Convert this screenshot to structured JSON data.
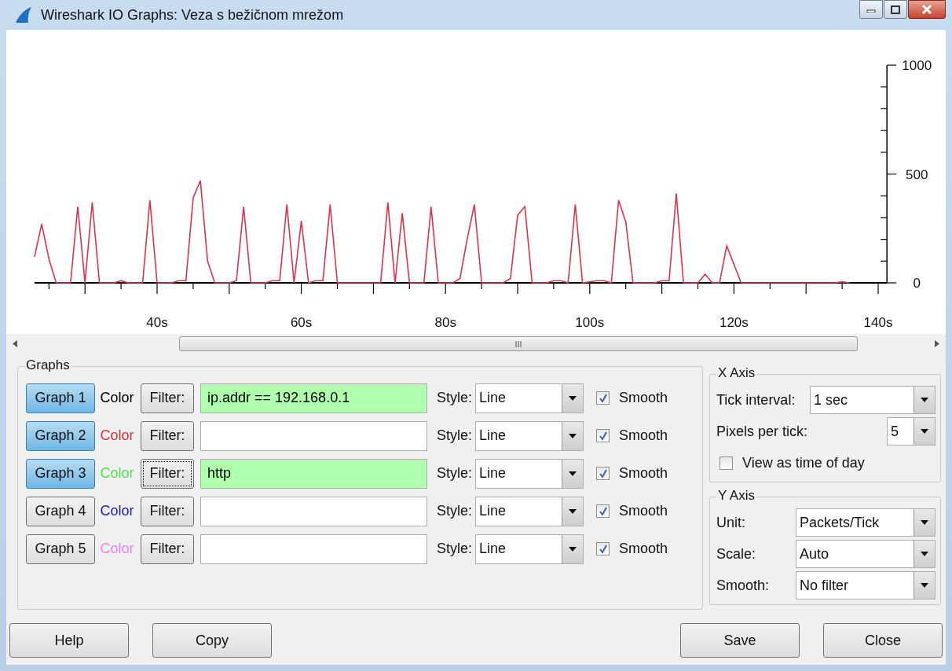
{
  "window": {
    "title": "Wireshark IO Graphs: Veza s bežičnom mrežom"
  },
  "chart": {
    "chart_data": {
      "type": "line",
      "x": [
        23,
        24,
        25,
        26,
        28,
        29,
        30,
        31,
        32,
        34,
        35,
        36,
        38,
        39,
        40,
        42,
        43,
        44,
        45,
        46,
        47,
        48,
        50,
        51,
        52,
        53,
        55,
        56,
        57,
        58,
        59,
        60,
        61,
        62,
        63,
        64,
        65,
        71,
        72,
        73,
        74,
        75,
        77,
        78,
        79,
        81,
        82,
        83,
        84,
        85,
        88,
        89,
        90,
        91,
        92,
        94,
        95,
        96,
        97,
        98,
        99,
        101,
        102,
        103,
        104,
        105,
        106,
        109,
        110,
        111,
        112,
        113,
        115,
        116,
        117,
        118,
        119,
        121,
        134,
        135,
        136
      ],
      "series": [
        {
          "color": "#e0304a",
          "values": [
            120,
            270,
            110,
            0,
            0,
            350,
            0,
            370,
            0,
            0,
            10,
            0,
            0,
            380,
            0,
            0,
            10,
            10,
            390,
            470,
            100,
            0,
            0,
            10,
            350,
            0,
            0,
            10,
            10,
            360,
            0,
            285,
            0,
            10,
            10,
            360,
            0,
            0,
            370,
            0,
            320,
            0,
            0,
            350,
            0,
            0,
            20,
            200,
            360,
            0,
            0,
            20,
            310,
            350,
            0,
            0,
            10,
            10,
            0,
            360,
            0,
            10,
            10,
            0,
            380,
            280,
            0,
            0,
            10,
            10,
            410,
            0,
            0,
            40,
            0,
            0,
            170,
            0,
            0,
            5,
            0
          ]
        }
      ],
      "xlim": [
        23,
        141
      ],
      "ylim": [
        0,
        1000
      ],
      "xticks": [
        {
          "value": 40,
          "label": "40s"
        },
        {
          "value": 60,
          "label": "60s"
        },
        {
          "value": 80,
          "label": "80s"
        },
        {
          "value": 100,
          "label": "100s"
        },
        {
          "value": 120,
          "label": "120s"
        },
        {
          "value": 140,
          "label": "140s"
        }
      ],
      "yticks": [
        0,
        500,
        1000
      ]
    }
  },
  "graphs": {
    "title": "Graphs",
    "rows": [
      {
        "button": "Graph 1",
        "on": true,
        "color_label": "Color",
        "color": "#000000",
        "filter_button": "Filter:",
        "focused": false,
        "filter": "ip.addr == 192.168.0.1",
        "valid": true,
        "style_label": "Style:",
        "style": "Line",
        "smooth_label": "Smooth",
        "smooth": true
      },
      {
        "button": "Graph 2",
        "on": true,
        "color_label": "Color",
        "color": "#e03030",
        "filter_button": "Filter:",
        "focused": false,
        "valid": false,
        "style_label": "Style:",
        "style": "Line",
        "smooth_label": "Smooth",
        "smooth": true
      },
      {
        "button": "Graph 3",
        "on": true,
        "color_label": "Color",
        "color": "#50e050",
        "filter_button": "Filter:",
        "focused": true,
        "filter": "http",
        "valid": true,
        "style_label": "Style:",
        "style": "Line",
        "smooth_label": "Smooth",
        "smooth": true
      },
      {
        "button": "Graph 4",
        "on": false,
        "color_label": "Color",
        "color": "#2020c0",
        "filter_button": "Filter:",
        "focused": false,
        "valid": false,
        "style_label": "Style:",
        "style": "Line",
        "smooth_label": "Smooth",
        "smooth": true
      },
      {
        "button": "Graph 5",
        "on": false,
        "color_label": "Color",
        "color": "#f080f0",
        "filter_button": "Filter:",
        "focused": false,
        "valid": false,
        "style_label": "Style:",
        "style": "Line",
        "smooth_label": "Smooth",
        "smooth": true
      }
    ]
  },
  "x_axis": {
    "title": "X Axis",
    "tick_interval_label": "Tick interval:",
    "tick_interval": "1 sec",
    "pixels_per_tick_label": "Pixels per tick:",
    "pixels_per_tick": "5",
    "time_of_day_label": "View as time of day",
    "time_of_day": false
  },
  "y_axis": {
    "title": "Y Axis",
    "fields": [
      {
        "label": "Unit:",
        "value": "Packets/Tick"
      },
      {
        "label": "Scale:",
        "value": "Auto"
      },
      {
        "label": "Smooth:",
        "value": "No filter"
      }
    ]
  },
  "left_buttons": [
    "Help",
    "Copy"
  ],
  "right_buttons": [
    "Save",
    "Close"
  ]
}
